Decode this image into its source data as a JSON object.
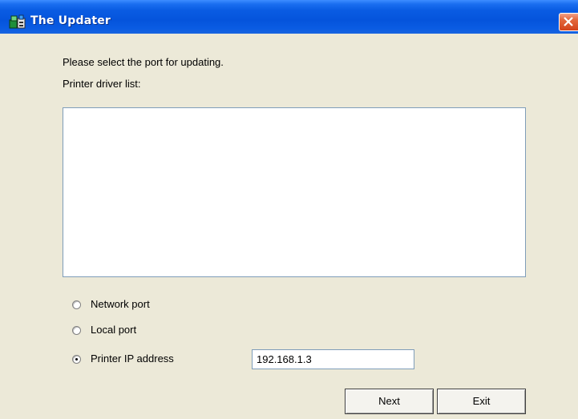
{
  "window": {
    "title": "The Updater",
    "icon": "updater-app-icon",
    "close_icon": "close-icon"
  },
  "content": {
    "instruction": "Please select the port for updating.",
    "driver_list_label": "Printer driver list:",
    "driver_list_items": []
  },
  "port_options": [
    {
      "label": "Network port",
      "selected": false
    },
    {
      "label": "Local port",
      "selected": false
    },
    {
      "label": "Printer IP address",
      "selected": true
    }
  ],
  "ip_field": {
    "value": "192.168.1.3"
  },
  "buttons": {
    "next_label": "Next",
    "exit_label": "Exit"
  },
  "colors": {
    "titlebar": "#0554dc",
    "close_button": "#e4693e",
    "dialog_background": "#ece9d8"
  }
}
